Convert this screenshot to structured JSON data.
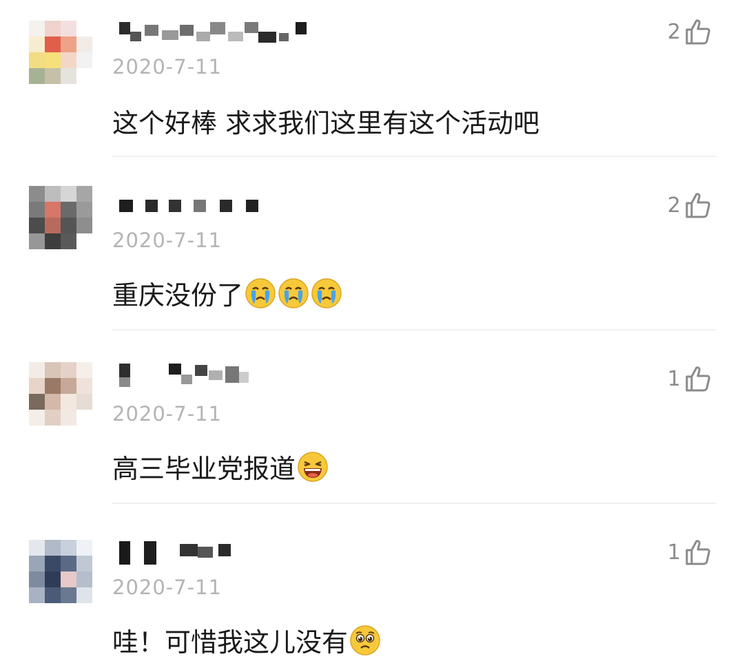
{
  "comments": [
    {
      "date": "2020-7-11",
      "likes": "2",
      "text": "这个好棒 求求我们这里有这个活动吧",
      "emojis": []
    },
    {
      "date": "2020-7-11",
      "likes": "2",
      "text": "重庆没份了",
      "emojis": [
        "crying-emoji",
        "crying-emoji",
        "crying-emoji"
      ]
    },
    {
      "date": "2020-7-11",
      "likes": "1",
      "text": "高三毕业党报道",
      "emojis": [
        "laughing-emoji"
      ]
    },
    {
      "date": "2020-7-11",
      "likes": "1",
      "text": "哇！可惜我这儿没有",
      "emojis": [
        "pleading-emoji"
      ]
    }
  ],
  "icons": {
    "like": "thumbs-up-icon"
  },
  "colors": {
    "text": "#1a1a1a",
    "meta": "#b4b4b4",
    "like": "#8a8a8a",
    "emoji_yellow": "#f7c93a",
    "tear_blue": "#4aa3e8"
  }
}
